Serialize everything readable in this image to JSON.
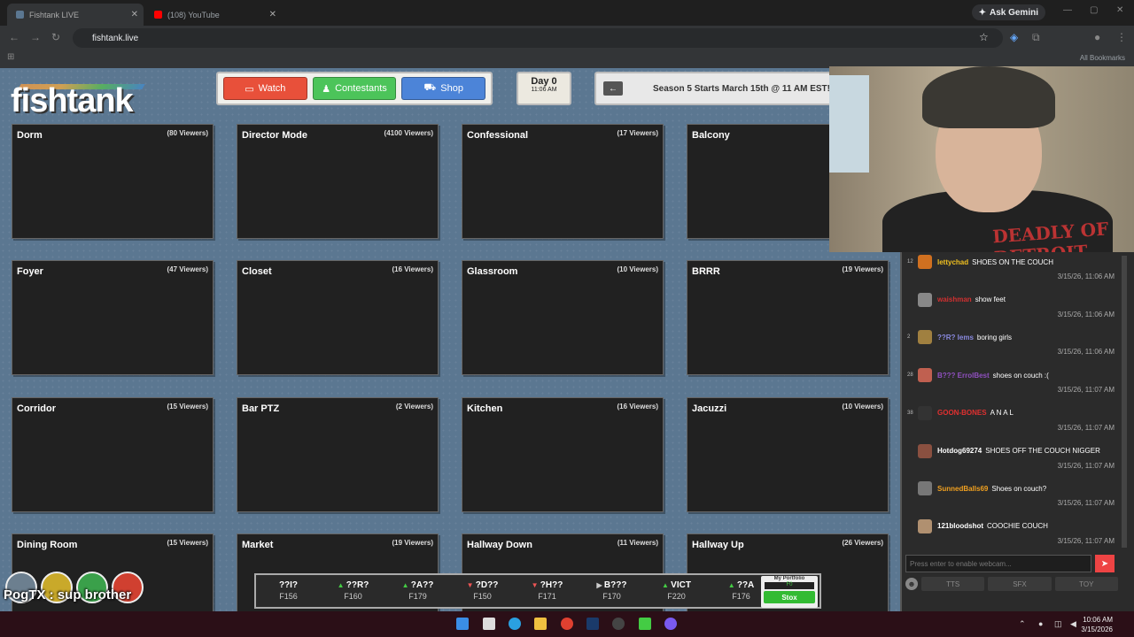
{
  "browser": {
    "tabs": [
      {
        "title": "Fishtank LIVE",
        "active": true,
        "favicon_color": "#5b7791"
      },
      {
        "title": "(108) YouTube",
        "active": false,
        "favicon_color": "#ff0000"
      }
    ],
    "ask_label": "Ask Gemini",
    "url": "fishtank.live",
    "all_bookmarks": "All Bookmarks"
  },
  "site": {
    "logo": "fishtank",
    "nav": [
      {
        "label": "Watch",
        "icon": "tv-icon",
        "color": "#e8503a"
      },
      {
        "label": "Contestants",
        "icon": "person-icon",
        "color": "#4cc45a"
      },
      {
        "label": "Shop",
        "icon": "cart-icon",
        "color": "#4c84d8"
      }
    ],
    "day": {
      "label": "Day 0",
      "time": "11:06 AM"
    },
    "announcement": "Season 5 Starts March 15th @ 11 AM EST!",
    "cameras": [
      {
        "name": "Dorm",
        "viewers": "(80 Viewers)"
      },
      {
        "name": "Director Mode",
        "viewers": "(4100 Viewers)"
      },
      {
        "name": "Confessional",
        "viewers": "(17 Viewers)"
      },
      {
        "name": "Balcony",
        "viewers": ""
      },
      {
        "name": "Foyer",
        "viewers": "(47 Viewers)"
      },
      {
        "name": "Closet",
        "viewers": "(16 Viewers)"
      },
      {
        "name": "Glassroom",
        "viewers": "(10 Viewers)"
      },
      {
        "name": "BRRR",
        "viewers": "(19 Viewers)"
      },
      {
        "name": "Corridor",
        "viewers": "(15 Viewers)"
      },
      {
        "name": "Bar PTZ",
        "viewers": "(2 Viewers)"
      },
      {
        "name": "Kitchen",
        "viewers": "(16 Viewers)"
      },
      {
        "name": "Jacuzzi",
        "viewers": "(10 Viewers)"
      },
      {
        "name": "Dining Room",
        "viewers": "(15 Viewers)"
      },
      {
        "name": "Market",
        "viewers": "(19 Viewers)"
      },
      {
        "name": "Hallway Down",
        "viewers": "(11 Viewers)"
      },
      {
        "name": "Hallway Up",
        "viewers": "(26 Viewers)"
      }
    ],
    "ticker": [
      {
        "symbol": "??I?",
        "dir": "none",
        "price": "F156"
      },
      {
        "symbol": "??R?",
        "dir": "up",
        "price": "F160"
      },
      {
        "symbol": "?A??",
        "dir": "up",
        "price": "F179"
      },
      {
        "symbol": "?D??",
        "dir": "down",
        "price": "F150"
      },
      {
        "symbol": "?H??",
        "dir": "down",
        "price": "F171"
      },
      {
        "symbol": "B???",
        "dir": "flat",
        "price": "F170"
      },
      {
        "symbol": "VICT",
        "dir": "up",
        "price": "F220"
      },
      {
        "symbol": "??A",
        "dir": "up",
        "price": "F176"
      }
    ],
    "portfolio": {
      "label": "My Portfolio",
      "value": "F0",
      "button": "Stox"
    }
  },
  "overlay": {
    "chatline": "PogTX : sup brother",
    "orb_colors": [
      "#6c7f8f",
      "#c9a92a",
      "#3aa04a",
      "#d04030"
    ]
  },
  "webcam": {
    "shirt_text": "DEADLY OF DETROIT"
  },
  "chat": {
    "messages": [
      {
        "level": "12",
        "user": "lettychad",
        "user_color": "#f0c020",
        "text": "SHOES ON THE COUCH",
        "time": "3/15/26, 11:06 AM"
      },
      {
        "level": "",
        "user": "waishman",
        "user_color": "#d03030",
        "text": "show feet",
        "time": "3/15/26, 11:06 AM"
      },
      {
        "level": "2",
        "user": "??R? lems",
        "user_color": "#8a8ae0",
        "text": "boring girls",
        "time": "3/15/26, 11:06 AM"
      },
      {
        "level": "28",
        "user": "B??? ErrolBest",
        "user_color": "#9050c0",
        "text": "shoes on couch :(",
        "time": "3/15/26, 11:07 AM"
      },
      {
        "level": "38",
        "user": "GOON-BONES",
        "user_color": "#e03030",
        "text": "A N A L",
        "time": "3/15/26, 11:07 AM"
      },
      {
        "level": "",
        "user": "Hotdog69274",
        "user_color": "#ffffff",
        "text": "SHOES OFF THE COUCH NIGGER",
        "time": "3/15/26, 11:07 AM"
      },
      {
        "level": "",
        "user": "SunnedBalls69",
        "user_color": "#f0a020",
        "text": "Shoes on couch?",
        "time": "3/15/26, 11:07 AM"
      },
      {
        "level": "",
        "user": "121bloodshot",
        "user_color": "#ffffff",
        "text": "COOCHIE COUCH",
        "time": "3/15/26, 11:07 AM"
      }
    ],
    "input_placeholder": "Press enter to enable webcam...",
    "buttons": [
      "TTS",
      "SFX",
      "TOY"
    ]
  },
  "taskbar": {
    "time": "10:06 AM",
    "date": "3/15/2026"
  }
}
